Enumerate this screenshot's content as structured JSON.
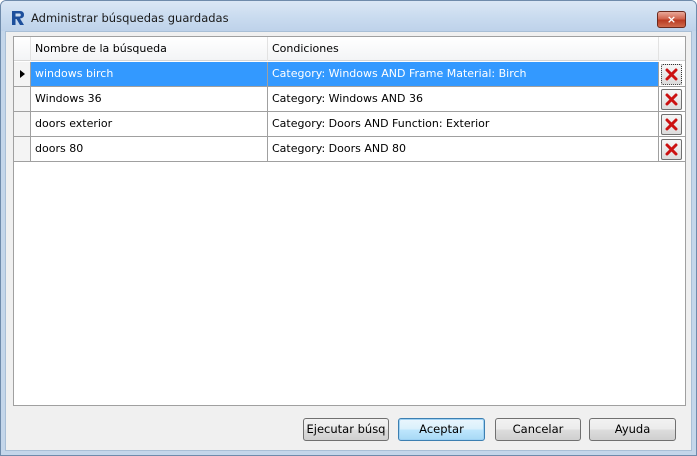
{
  "window": {
    "title": "Administrar búsquedas guardadas",
    "close_label": "×"
  },
  "grid": {
    "columns": [
      "Nombre de la búsqueda",
      "Condiciones"
    ],
    "rows": [
      {
        "name": "windows birch",
        "conditions": "Category: Windows AND Frame Material: Birch",
        "selected": true
      },
      {
        "name": "Windows 36",
        "conditions": "Category: Windows AND 36"
      },
      {
        "name": "doors exterior",
        "conditions": "Category: Doors AND Function: Exterior"
      },
      {
        "name": "doors 80",
        "conditions": "Category: Doors AND 80"
      }
    ]
  },
  "buttons": {
    "run": "Ejecutar búsq",
    "ok": "Aceptar",
    "cancel": "Cancelar",
    "help": "Ayuda"
  },
  "colors": {
    "selection": "#3399ff",
    "delete_icon": "#cc1111"
  }
}
